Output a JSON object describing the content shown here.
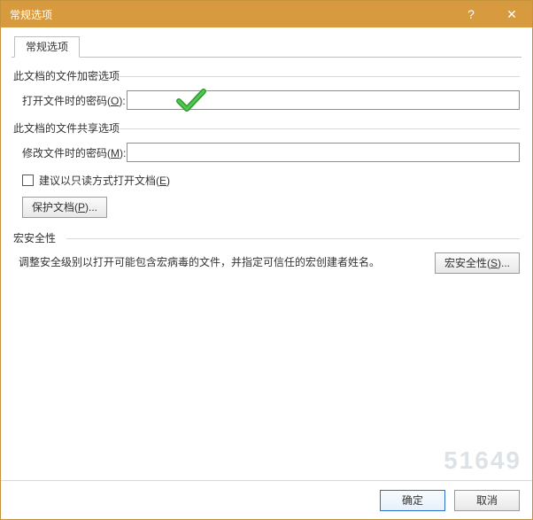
{
  "window": {
    "title": "常规选项",
    "help": "?",
    "close": "✕"
  },
  "tab": {
    "label": "常规选项"
  },
  "encrypt": {
    "legend": "此文档的文件加密选项",
    "open_label_pre": "打开文件时的密码(",
    "open_key": "O",
    "open_label_post": "):",
    "open_value": ""
  },
  "share": {
    "legend": "此文档的文件共享选项",
    "modify_label_pre": "修改文件时的密码(",
    "modify_key": "M",
    "modify_label_post": "):",
    "modify_value": "",
    "readonly_pre": "建议以只读方式打开文档(",
    "readonly_key": "E",
    "readonly_post": ")",
    "readonly_checked": false,
    "protect_pre": "保护文档(",
    "protect_key": "P",
    "protect_post": ")..."
  },
  "macro": {
    "legend": "宏安全性",
    "desc": "调整安全级别以打开可能包含宏病毒的文件，并指定可信任的宏创建者姓名。",
    "btn_pre": "宏安全性(",
    "btn_key": "S",
    "btn_post": ")..."
  },
  "footer": {
    "ok": "确定",
    "cancel": "取消"
  }
}
